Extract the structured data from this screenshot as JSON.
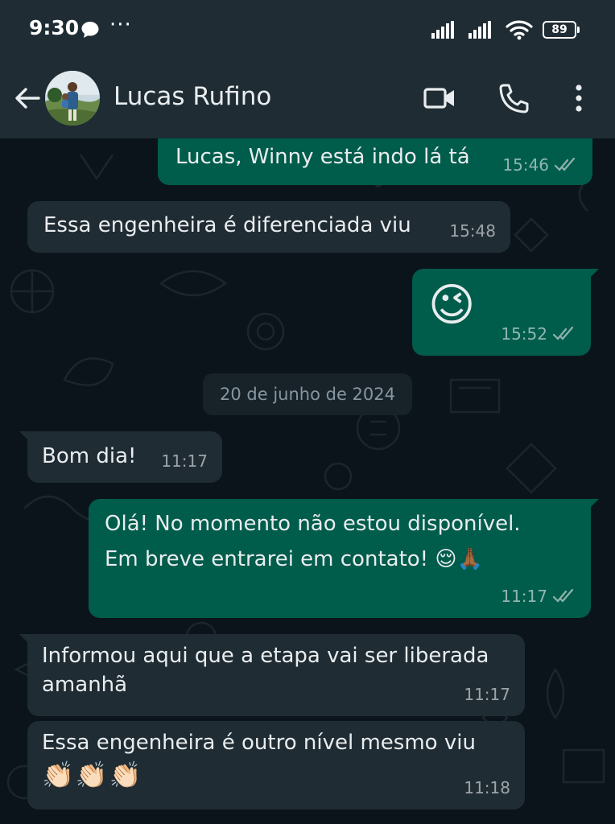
{
  "status_bar": {
    "time": "9:30",
    "more_dots": "···",
    "battery": "89"
  },
  "header": {
    "contact_name": "Lucas Rufino",
    "icons": [
      "back-arrow-icon",
      "video-call-icon",
      "voice-call-icon",
      "more-options-icon"
    ]
  },
  "chat": {
    "date_divider": "20 de junho de 2024",
    "messages": [
      {
        "direction": "outgoing",
        "text": "Lucas, Winny está indo lá tá",
        "time": "15:46",
        "status": "read"
      },
      {
        "direction": "incoming",
        "text": "Essa engenheira é diferenciada viu",
        "time": "15:48"
      },
      {
        "direction": "outgoing",
        "text": "😉",
        "time": "15:52",
        "status": "read"
      },
      {
        "direction": "incoming",
        "text": "Bom dia!",
        "time": "11:17"
      },
      {
        "direction": "outgoing",
        "text_line1": "Olá! No momento não estou disponível.",
        "text_line2": "Em breve entrarei em contato! 😌🙏🏾",
        "time": "11:17",
        "status": "read"
      },
      {
        "direction": "incoming",
        "text_line1": "Informou aqui que a etapa vai ser liberada",
        "text_line2": "amanhã",
        "time": "11:17"
      },
      {
        "direction": "incoming",
        "text_line1": "Essa engenheira é outro nível mesmo viu",
        "text_line2": "👏🏻👏🏻👏🏻",
        "time": "11:18"
      }
    ]
  },
  "colors": {
    "header_bg": "#1f2c34",
    "chat_bg": "#0b141a",
    "incoming_bubble": "#202c33",
    "outgoing_bubble": "#005c4b",
    "read_ticks": "#8fb3ab"
  }
}
